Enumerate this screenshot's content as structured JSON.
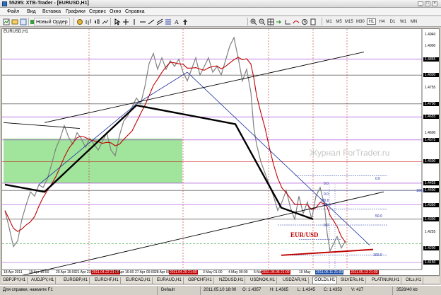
{
  "window": {
    "title": "55295: XTB-Trader - [EURUSD,H1]",
    "min": "_",
    "max": "□",
    "close": "×"
  },
  "menu": [
    "Файл",
    "Вид",
    "Вставка",
    "Графики",
    "Сервис",
    "Окно",
    "Справка"
  ],
  "toolbar": {
    "new_order": "Новый Ордер",
    "timeframes": [
      "M1",
      "M5",
      "M15",
      "M30",
      "H1",
      "H4",
      "D1",
      "W1",
      "MN"
    ],
    "selected_timeframe": "H1"
  },
  "chart": {
    "title": "EURUSD,H1",
    "watermark": "Журнал ForTrader.ru",
    "symbol_label": "EUR/USD",
    "price_labels": [
      "1.4940",
      "1.4900",
      "1.4855",
      "1.4800",
      "1.4755",
      "1.4700",
      "1.4655",
      "1.4600",
      "1.4575",
      "1.4500",
      "1.4425",
      "1.4400",
      "1.4350",
      "1.4300",
      "1.4255",
      "1.4200",
      "1.4150"
    ],
    "highlight_prices": [
      "1.4855",
      "1.4800",
      "1.4700",
      "1.4655",
      "1.4575",
      "1.4500",
      "1.4425",
      "1.4400",
      "1.4350",
      "1.4300",
      "1.4200",
      "1.4150"
    ],
    "date_labels": [
      {
        "text": "18 Apr 2011",
        "style": ""
      },
      {
        "text": "19 Apr 15:00",
        "style": ""
      },
      {
        "text": "20 Apr 15:00",
        "style": ""
      },
      {
        "text": "21 Apr 23:00",
        "style": ""
      },
      {
        "text": "2011.04.22 21:00",
        "style": "hl"
      },
      {
        "text": "26 Apr 16:00",
        "style": ""
      },
      {
        "text": "27 Apr 00:00",
        "style": ""
      },
      {
        "text": "28 Apr 00:00",
        "style": ""
      },
      {
        "text": "2011.04.29 21:00",
        "style": "hl"
      },
      {
        "text": "3 May 01:00",
        "style": ""
      },
      {
        "text": "4 May 09:00",
        "style": ""
      },
      {
        "text": "5 May",
        "style": ""
      },
      {
        "text": "2011.05.06 21:00",
        "style": "hl"
      },
      {
        "text": "10 May",
        "style": ""
      },
      {
        "text": "2011.05.11 21:00",
        "style": "hlb"
      },
      {
        "text": "2011.05.13 21:00",
        "style": "hl"
      }
    ],
    "fib_labels": [
      "0.0",
      "0.0",
      "100.0",
      "0.0",
      "50.0",
      "100.0",
      "100.0",
      "50.0",
      "0.0"
    ]
  },
  "tabs": [
    "GBPJPY,H1",
    "AUDJPY,H1",
    "EURGBP,H1",
    "EURCHF,H1",
    "EURCAD,H1",
    "EURAUD,H1",
    "GBPCHF,H1",
    "NZDUSD,H1",
    "USDNOK,H1",
    "USDZAR,H1",
    "GOLDs,H1",
    "SILVERs,H1",
    "PLATINUM,H1",
    "OILs,H1"
  ],
  "active_tab": "GOLDs,H1",
  "status": {
    "help": "Для справки, нажмите F1",
    "profile": "Default",
    "datetime": "2011.05.10 18:00",
    "open": "O: 1.4357",
    "high": "H: 1.4365",
    "low": "L: 1.4345",
    "close": "C: 1.4353",
    "volume": "V: 427",
    "traffic": "3528/40 kb"
  },
  "colors": {
    "bg": "#ffffff",
    "candle": "#808080",
    "ma": "#c00000",
    "trend": "#000000",
    "channel": "#1d2fa0",
    "zone": "#8fe08a",
    "level": "#9b30d0"
  }
}
